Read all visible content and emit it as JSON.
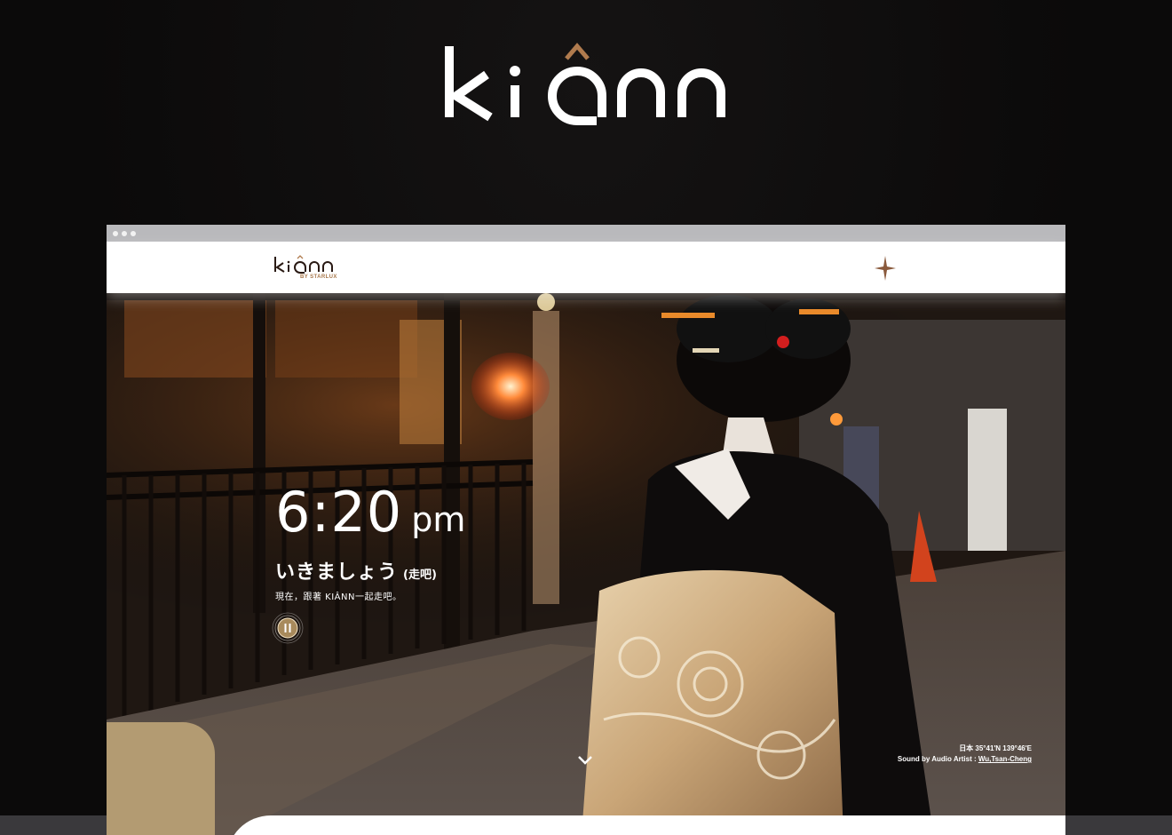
{
  "brand": {
    "logo_text": "kiânn",
    "byline": "BY STARLUX"
  },
  "hero": {
    "time": "6:20",
    "ampm": "pm",
    "japanese": "いきましょう",
    "japanese_translation": "(走吧)",
    "tagline": "現在，跟著 KIÂNN一起走吧。"
  },
  "credits": {
    "location": "日本  35°41'N 139°46'E",
    "sound_prefix": "Sound by Audio Artist : ",
    "artist": "Wu,Tsan-Cheng"
  },
  "icons": {
    "menu": "compass-star-icon",
    "pause": "pause-icon",
    "scroll": "chevron-down-icon"
  },
  "colors": {
    "gold": "#b39b72",
    "brand_brown": "#a8784c",
    "logo_accent": "#b07b4e",
    "page_bg": "#0b0a0a"
  }
}
